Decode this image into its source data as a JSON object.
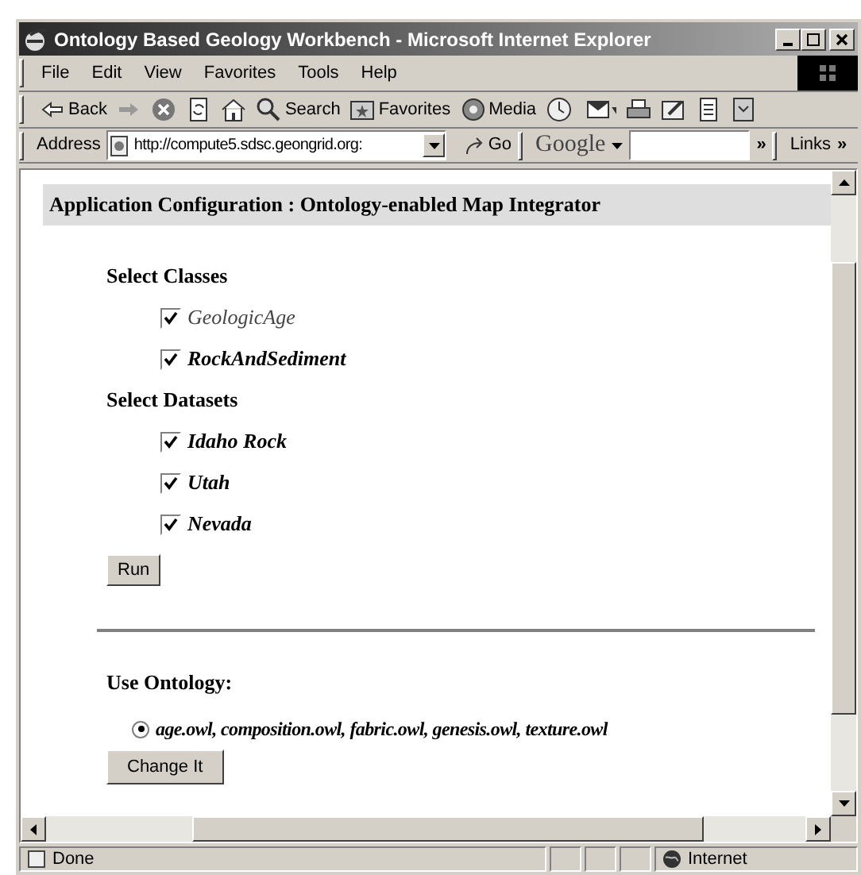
{
  "window": {
    "title": "Ontology Based Geology Workbench - Microsoft Internet Explorer"
  },
  "menu": [
    "File",
    "Edit",
    "View",
    "Favorites",
    "Tools",
    "Help"
  ],
  "toolbar": [
    {
      "kind": "back",
      "label": "Back"
    },
    {
      "kind": "forward"
    },
    {
      "kind": "stop"
    },
    {
      "kind": "refresh"
    },
    {
      "kind": "home"
    },
    {
      "kind": "search",
      "label": "Search"
    },
    {
      "kind": "favorites",
      "label": "Favorites"
    },
    {
      "kind": "media",
      "label": "Media"
    },
    {
      "kind": "history"
    },
    {
      "kind": "mail"
    },
    {
      "kind": "print"
    },
    {
      "kind": "edit"
    },
    {
      "kind": "discuss"
    },
    {
      "kind": "messenger"
    }
  ],
  "address_bar": {
    "label": "Address",
    "url": "http://compute5.sdsc.geongrid.org:",
    "go": "Go",
    "search_brand": "Google",
    "chevron": "»",
    "links": "Links",
    "links_chevron": "»"
  },
  "page": {
    "heading": "Application Configuration : Ontology-enabled Map Integrator",
    "classes": {
      "title": "Select Classes",
      "items": [
        {
          "label": "GeologicAge",
          "checked": true,
          "dim": true
        },
        {
          "label": "RockAndSediment",
          "checked": true,
          "dim": false
        }
      ]
    },
    "datasets": {
      "title": "Select Datasets",
      "items": [
        {
          "label": "Idaho Rock",
          "checked": true
        },
        {
          "label": "Utah",
          "checked": true
        },
        {
          "label": "Nevada",
          "checked": true
        }
      ]
    },
    "run_button": "Run",
    "ontology": {
      "title": "Use Ontology:",
      "options": [
        {
          "label": "age.owl, composition.owl, fabric.owl, genesis.owl, texture.owl",
          "selected": true
        }
      ]
    },
    "change_button": "Change It"
  },
  "status_bar": {
    "text": "Done",
    "zone": "Internet"
  }
}
